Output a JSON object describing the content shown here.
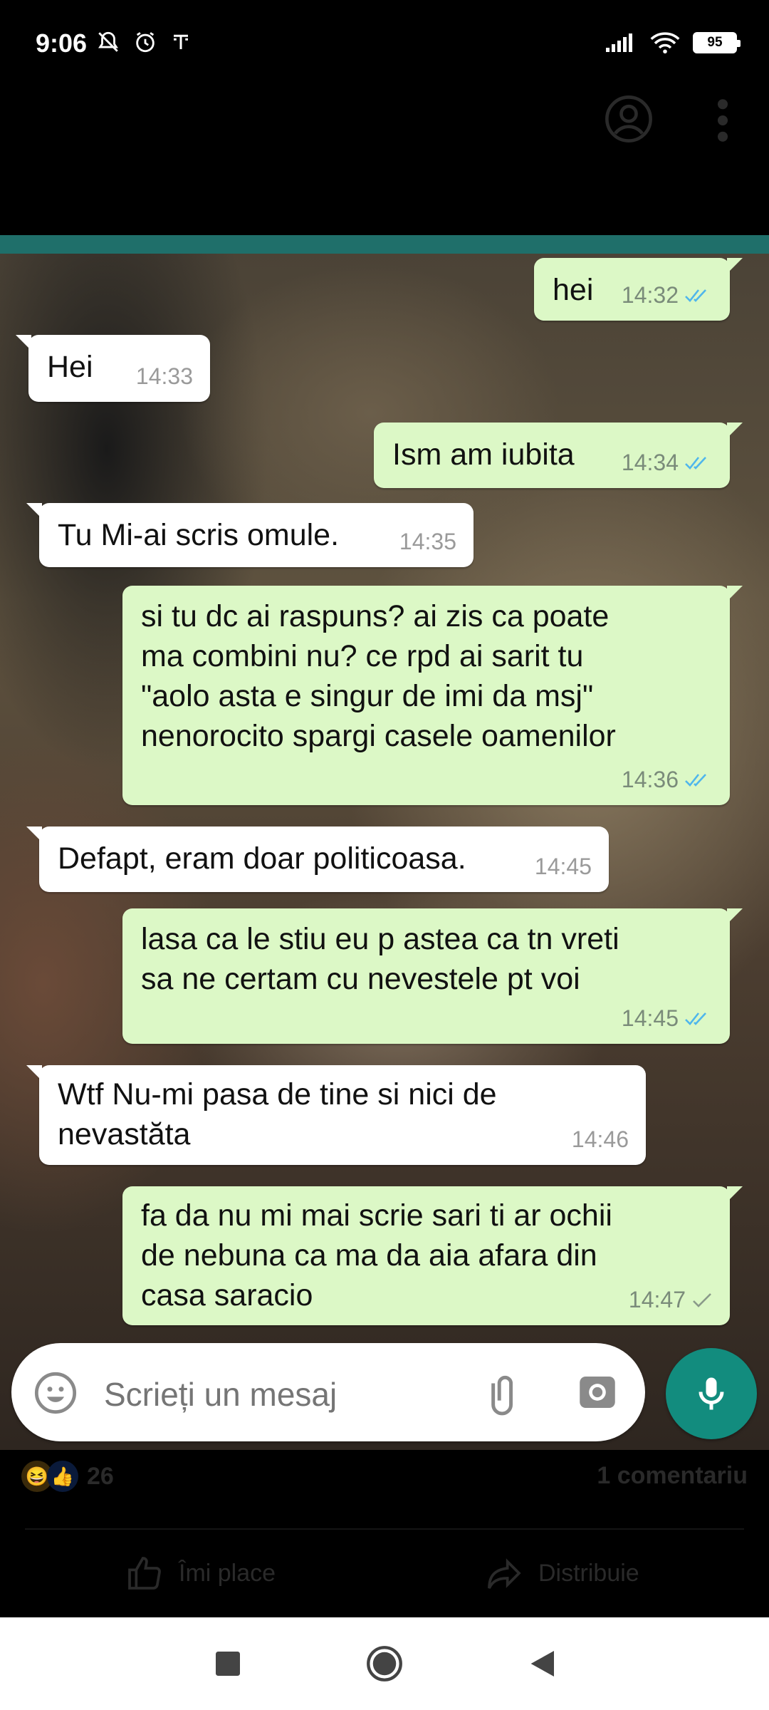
{
  "status_bar": {
    "time": "9:06",
    "battery": "95"
  },
  "chat": {
    "messages": [
      {
        "direction": "out",
        "text": "hei",
        "time": "14:32",
        "ticks": "read"
      },
      {
        "direction": "in",
        "text": "Hei",
        "time": "14:33"
      },
      {
        "direction": "out",
        "text": "Ism am iubita",
        "time": "14:34",
        "ticks": "read"
      },
      {
        "direction": "in",
        "text": "Tu Mi-ai scris omule.",
        "time": "14:35"
      },
      {
        "direction": "out",
        "text": "si tu dc ai raspuns? ai zis ca poate\nma combini nu? ce rpd ai sarit tu\n\"aolo asta e singur de imi da msj\"\nnenorocito spargi casele oamenilor",
        "time": "14:36",
        "ticks": "read"
      },
      {
        "direction": "in",
        "text": "Defapt, eram doar politicoasa.",
        "time": "14:45"
      },
      {
        "direction": "out",
        "text": "lasa ca le stiu eu p astea ca tn vreti\nsa ne certam cu nevestele pt voi",
        "time": "14:45",
        "ticks": "read"
      },
      {
        "direction": "in",
        "text": "Wtf Nu-mi pasa de tine si nici de\nnevastăta",
        "time": "14:46"
      },
      {
        "direction": "out",
        "text": "fa da nu mi mai scrie sari ti ar ochii\nde nebuna ca ma da aia afara din\ncasa saracio",
        "time": "14:47",
        "ticks": "sent"
      }
    ],
    "input_placeholder": "Scrieți un mesaj"
  },
  "post": {
    "reactions_count": "26",
    "comments_label": "1 comentariu",
    "like_label": "Îmi place",
    "share_label": "Distribuie"
  },
  "colors": {
    "outgoing_bubble": "#dcf8c6",
    "incoming_bubble": "#ffffff",
    "read_tick": "#4fb6ec",
    "whatsapp_green": "#128c7e"
  }
}
